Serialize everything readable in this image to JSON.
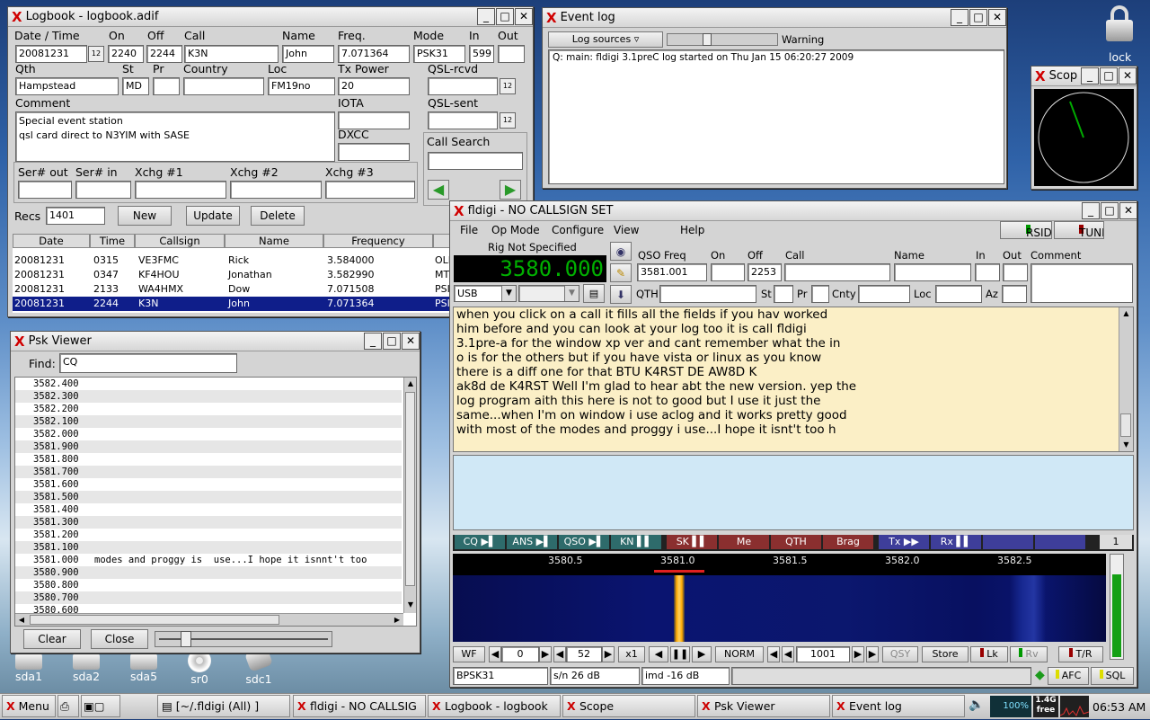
{
  "logbook": {
    "title": "Logbook - logbook.adif",
    "labels": {
      "date": "Date / Time",
      "on": "On",
      "off": "Off",
      "call": "Call",
      "name": "Name",
      "freq": "Freq.",
      "mode": "Mode",
      "in": "In",
      "out": "Out",
      "qth": "Qth",
      "st": "St",
      "pr": "Pr",
      "country": "Country",
      "loc": "Loc",
      "txpower": "Tx Power",
      "qslrcvd": "QSL-rcvd",
      "comment": "Comment",
      "iota": "IOTA",
      "qslsent": "QSL-sent",
      "dxcc": "DXCC",
      "callsearch": "Call Search",
      "serout": "Ser# out",
      "serin": "Ser# in",
      "x1": "Xchg #1",
      "x2": "Xchg #2",
      "x3": "Xchg #3",
      "recs": "Recs"
    },
    "values": {
      "date": "20081231",
      "on": "2240",
      "off": "2244",
      "call": "K3N",
      "name": "John",
      "freq": "7.071364",
      "mode": "PSK31",
      "in": "599",
      "out": "",
      "qth": "Hampstead",
      "st": "MD",
      "pr": "",
      "country": "",
      "loc": "FM19no",
      "txpower": "20",
      "comment1": "Special event station",
      "comment2": "qsl card direct to N3YIM with SASE",
      "recs": "1401"
    },
    "buttons": {
      "new": "New",
      "update": "Update",
      "delete": "Delete"
    },
    "columns": [
      "Date",
      "Time",
      "Callsign",
      "Name",
      "Frequency"
    ],
    "rows": [
      [
        "20081231",
        "0315",
        "VE3FMC",
        "Rick",
        "3.584000",
        "OLI"
      ],
      [
        "20081231",
        "0347",
        "KF4HOU",
        "Jonathan",
        "3.582990",
        "MT"
      ],
      [
        "20081231",
        "2133",
        "WA4HMX",
        "Dow",
        "7.071508",
        "PSI"
      ],
      [
        "20081231",
        "2244",
        "K3N",
        "John",
        "7.071364",
        "PSI"
      ]
    ]
  },
  "eventlog": {
    "title": "Event log",
    "sources": "Log sources",
    "level": "Warning",
    "level_value": 0.35,
    "line": "Q: main: fldigi 3.1preC log started on Thu Jan 15 06:20:27 2009"
  },
  "scope": {
    "title": "Scop"
  },
  "lock": {
    "label": "lock"
  },
  "psk": {
    "title": "Psk Viewer",
    "find_label": "Find:",
    "find_value": "CQ",
    "rows": [
      [
        "3582.400",
        ""
      ],
      [
        "3582.300",
        ""
      ],
      [
        "3582.200",
        ""
      ],
      [
        "3582.100",
        ""
      ],
      [
        "3582.000",
        ""
      ],
      [
        "3581.900",
        ""
      ],
      [
        "3581.800",
        ""
      ],
      [
        "3581.700",
        ""
      ],
      [
        "3581.600",
        ""
      ],
      [
        "3581.500",
        ""
      ],
      [
        "3581.400",
        ""
      ],
      [
        "3581.300",
        ""
      ],
      [
        "3581.200",
        ""
      ],
      [
        "3581.100",
        ""
      ],
      [
        "3581.000",
        "modes and proggy is  use...I hope it isnnt't too"
      ],
      [
        "3580.900",
        ""
      ],
      [
        "3580.800",
        ""
      ],
      [
        "3580.700",
        ""
      ],
      [
        "3580.600",
        ""
      ]
    ],
    "clear": "Clear",
    "close": "Close",
    "slider_value": 0.15
  },
  "fldigi": {
    "title": "fldigi - NO CALLSIGN SET",
    "menu": [
      "File",
      "Op Mode",
      "Configure",
      "View",
      "Help"
    ],
    "rsid": "RSID",
    "tune": "TUNE",
    "rig": "Rig Not Specified",
    "freq_display": "3580.000",
    "mode_sel": "USB",
    "labels": {
      "qsofreq": "QSO Freq",
      "on": "On",
      "off": "Off",
      "call": "Call",
      "name": "Name",
      "in": "In",
      "out": "Out",
      "comment": "Comment",
      "qth": "QTH",
      "st": "St",
      "pr": "Pr",
      "cnty": "Cnty",
      "loc": "Loc",
      "az": "Az"
    },
    "values": {
      "qsofreq": "3581.001",
      "off": "2253"
    },
    "rx_text": [
      "when you click on a call it fills all the fields if you hav worked",
      "him before and you can look at your log too it is call fldigi",
      "3.1pre-a for the window xp ver and cant remember what the in",
      "o is for the others but if you have vista or linux as you know",
      "there is a diff one for that BTU K4RST DE AW8D K",
      "ak8d de K4RST Well I'm glad to hear abt the new version. yep the",
      "log program  aith this here is not to good but I use it just the",
      "same...when I'm on window i use aclog and it works pretty good",
      "with most of the modes and proggy i use...I hope it isnt't too h"
    ],
    "macros": [
      "CQ ▶▌",
      "ANS ▶▌",
      "QSO ▶▌",
      "KN ▌▌",
      "SK ▌▌",
      "Me",
      "QTH",
      "Brag",
      "Tx ▶▶",
      "Rx ▌▌",
      "",
      ""
    ],
    "macro_page": "1",
    "wf_ticks": [
      "3580.5",
      "3581.0",
      "3581.5",
      "3582.0",
      "3582.5"
    ],
    "ctrl": {
      "wf": "WF",
      "offset": "0",
      "speed": "52",
      "zoom": "x1",
      "norm": "NORM",
      "carrier": "1001",
      "qsy": "QSY",
      "store": "Store",
      "lk": "Lk",
      "rv": "Rv",
      "tr": "T/R"
    },
    "status": {
      "mode": "BPSK31",
      "sn": "s/n 26 dB",
      "imd": "imd -16 dB",
      "afc": "AFC",
      "sql": "SQL"
    }
  },
  "desktop": [
    "sda1",
    "sda2",
    "sda5",
    "sr0",
    "sdc1"
  ],
  "taskbar": {
    "menu": "Menu",
    "items": [
      "[~/.fldigi (All) ]",
      "fldigi - NO CALLSIG",
      "Logbook - logbook",
      "Scope",
      "Psk Viewer",
      "Event log"
    ],
    "cpu": "100%",
    "mem": "1.4G free",
    "time": "06:53 AM"
  }
}
